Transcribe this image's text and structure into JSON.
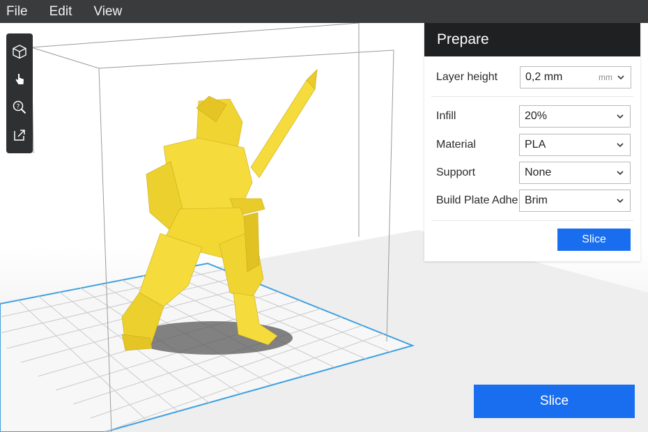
{
  "menu": {
    "items": [
      "File",
      "Edit",
      "View"
    ]
  },
  "toolbar": {
    "tools": [
      "cube-icon",
      "hand-pointer-icon",
      "zoom-help-icon",
      "open-external-icon"
    ]
  },
  "panel": {
    "title": "Prepare",
    "layer_height": {
      "label": "Layer height",
      "value": "0,2 mm",
      "unit": "mm"
    },
    "infill": {
      "label": "Infill",
      "value": "20%"
    },
    "material": {
      "label": "Material",
      "value": "PLA"
    },
    "support": {
      "label": "Support",
      "value": "None"
    },
    "adhesion": {
      "label": "Build Plate Adhe",
      "value": "Brim"
    },
    "slice_label": "Slice"
  },
  "slice_button": {
    "label": "Slice"
  },
  "colors": {
    "accent": "#196ef0",
    "model": "#f5dc3c",
    "plate_outline": "#3ea0e0",
    "panel_header": "#1f2022"
  }
}
